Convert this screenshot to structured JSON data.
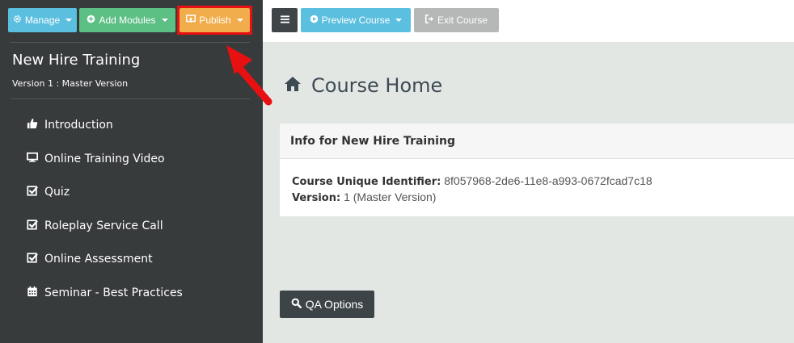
{
  "toolbar": {
    "manage_label": "Manage",
    "add_modules_label": "Add Modules",
    "publish_label": "Publish",
    "preview_label": "Preview Course",
    "exit_label": "Exit Course"
  },
  "sidebar": {
    "course_title": "New Hire Training",
    "version_label": "Version 1 : Master Version",
    "items": [
      {
        "label": "Introduction",
        "icon": "thumbs-up-icon"
      },
      {
        "label": "Online Training Video",
        "icon": "monitor-icon"
      },
      {
        "label": "Quiz",
        "icon": "checkbox-icon"
      },
      {
        "label": "Roleplay Service Call",
        "icon": "checkbox-icon"
      },
      {
        "label": "Online Assessment",
        "icon": "checkbox-icon"
      },
      {
        "label": "Seminar - Best Practices",
        "icon": "calendar-icon"
      }
    ]
  },
  "main": {
    "page_title": "Course Home",
    "card": {
      "header": "Info for New Hire Training",
      "identifier_label": "Course Unique Identifier:",
      "identifier_value": "8f057968-2de6-11e8-a993-0672fcad7c18",
      "version_label": "Version:",
      "version_value": "1 (Master Version)"
    },
    "qa_button_label": "QA Options"
  },
  "colors": {
    "manage": "#5bc0de",
    "add_modules": "#5cb85c",
    "publish": "#f0ad4e",
    "highlight": "#e81010",
    "sidebar_bg": "#383b3c",
    "main_bg": "#e3e7e3"
  }
}
